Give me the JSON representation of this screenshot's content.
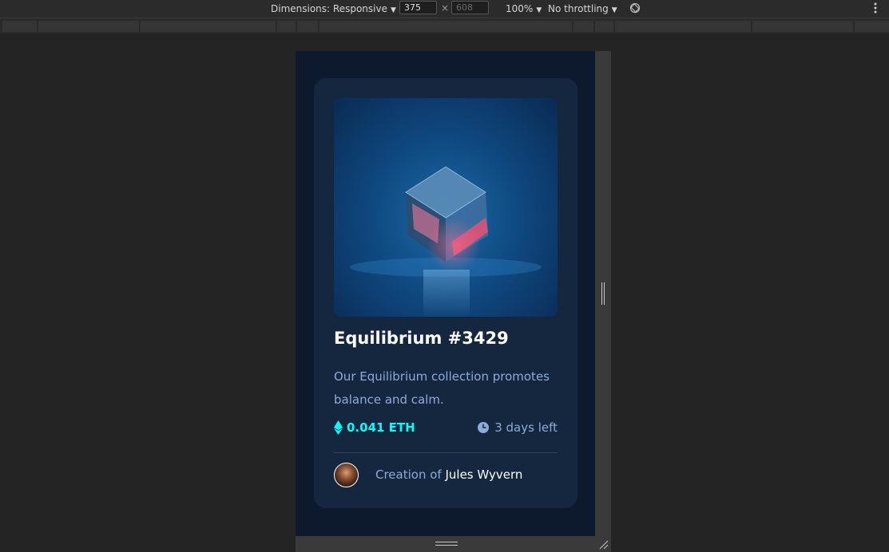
{
  "devtools": {
    "dimensions_label": "Dimensions: Responsive",
    "width_value": "375",
    "height_placeholder": "608",
    "dimension_separator": "×",
    "zoom": "100%",
    "throttling": "No throttling",
    "icons": [
      "rotate-icon",
      "more-options-icon"
    ]
  },
  "card": {
    "image_alt": "Equilibrium cube",
    "title": "Equilibrium #3429",
    "description": "Our Equilibrium collection promotes balance and calm.",
    "price": "0.041 ETH",
    "time_left": "3 days left",
    "creation_prefix": "Creation of",
    "creator_name": "Jules Wyvern",
    "icons": [
      "ethereum-icon",
      "clock-icon",
      "avatar"
    ]
  },
  "colors": {
    "page_bg": "#0d192c",
    "card_bg": "#15263f",
    "soft_blue": "#8bacd9",
    "cyan": "#00fff7",
    "white": "#ffffff",
    "devtools_bg": "#242424"
  }
}
